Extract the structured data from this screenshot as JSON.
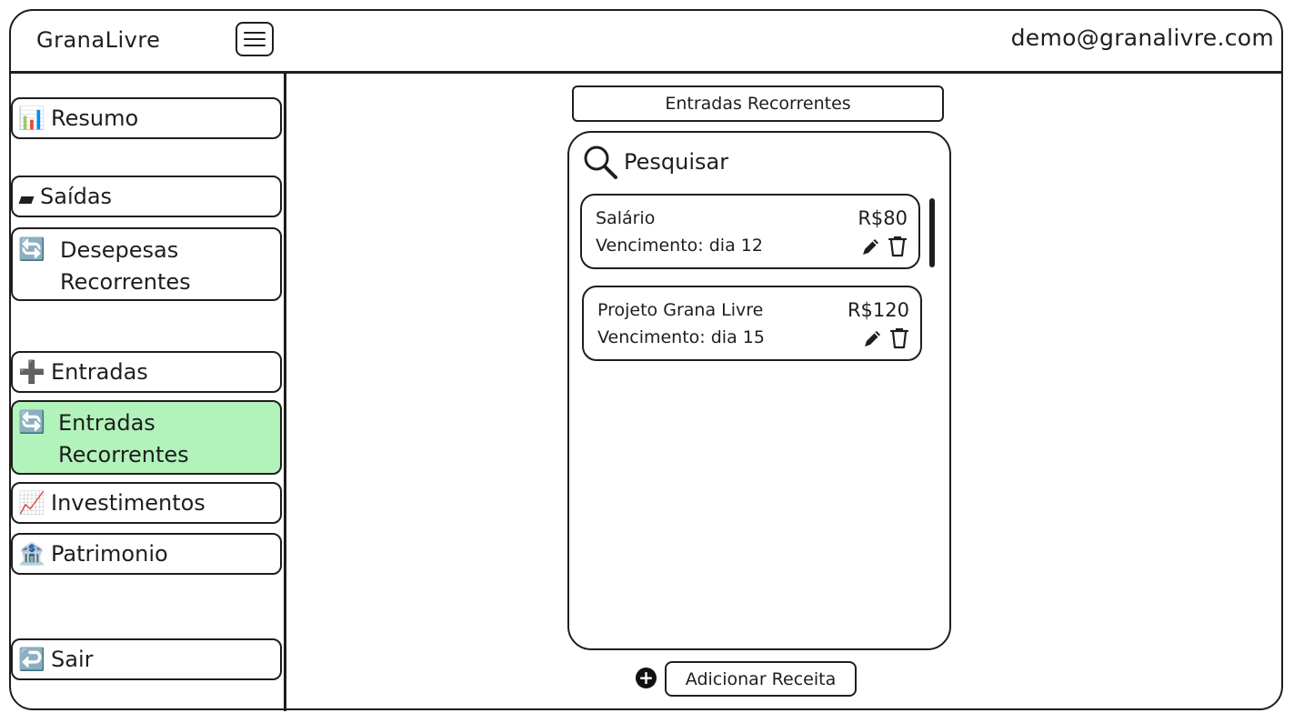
{
  "header": {
    "app_title": "GranaLivre",
    "user_email": "demo@granalivre.com",
    "menu_icon": "hamburger-icon"
  },
  "sidebar": {
    "items": [
      {
        "label": "Resumo",
        "icon": "📊"
      },
      {
        "label": "Saídas",
        "icon": "square-icon"
      },
      {
        "label_line1": "Desepesas",
        "label_line2": "Recorrentes",
        "icon": "🔄"
      },
      {
        "label": "Entradas",
        "icon": "➕"
      },
      {
        "label_line1": "Entradas",
        "label_line2": "Recorrentes",
        "icon": "🔄",
        "active": true
      },
      {
        "label": "Investimentos",
        "icon": "📈"
      },
      {
        "label": "Patrimonio",
        "icon": "🏦"
      },
      {
        "label": "Sair",
        "icon": "↩️"
      }
    ]
  },
  "main": {
    "title": "Entradas Recorrentes",
    "search_label": "Pesquisar",
    "entries": [
      {
        "name": "Salário",
        "amount": "R$80",
        "due": "Vencimento: dia 12"
      },
      {
        "name": "Projeto Grana Livre",
        "amount": "R$120",
        "due": "Vencimento: dia 15"
      }
    ],
    "add_button_label": "Adicionar Receita"
  },
  "colors": {
    "active_item": "#b2f2bb",
    "stroke": "#1e1e1e"
  }
}
